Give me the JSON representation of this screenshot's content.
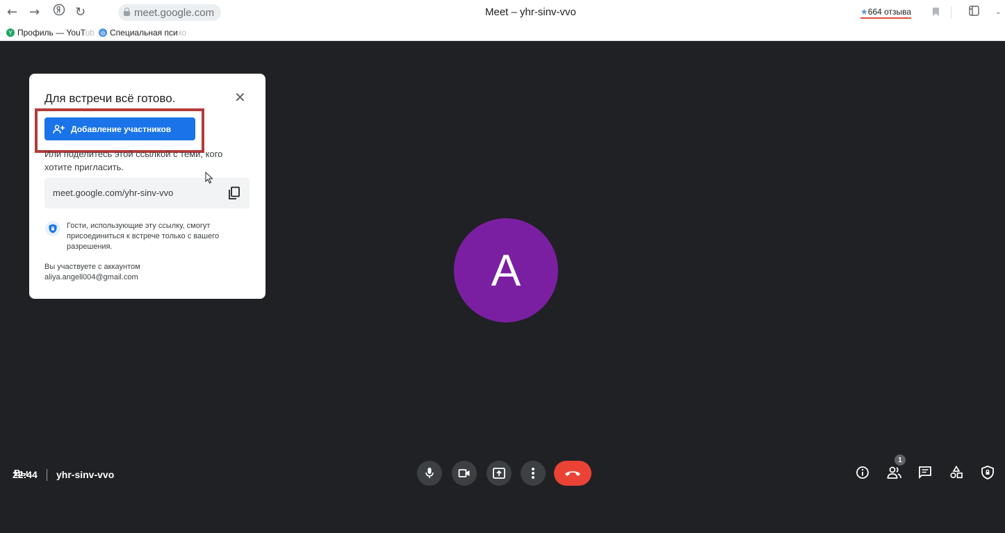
{
  "browser": {
    "url": "meet.google.com",
    "tab_title": "Meet – yhr-sinv-vvo",
    "reviews_star": "★",
    "reviews_label": "664 отзыва",
    "bookmarks": [
      {
        "label": "Профиль — YouT",
        "fade": "ub"
      },
      {
        "label": "Специальная пси",
        "fade": "хо"
      }
    ]
  },
  "panel": {
    "title": "Для встречи всё готово.",
    "add_button_label": "Добавление участников",
    "share_text": "Или поделитесь этой ссылкой с теми, кого хотите пригласить.",
    "meeting_link": "meet.google.com/yhr-sinv-vvo",
    "guest_notice": "Гости, использующие эту ссылку, смогут присоединиться к встрече только с вашего разрешения.",
    "account_label": "Вы участвуете с аккаунтом",
    "account_email": "aliya.angell004@gmail.com"
  },
  "stage": {
    "avatar_letter": "A",
    "self_label": "Вы"
  },
  "footer": {
    "time": "22:44",
    "meeting_code": "yhr-sinv-vvo",
    "participants_count": "1"
  },
  "colors": {
    "background": "#202124",
    "avatar": "#7b1fa2",
    "primary_button": "#1a73e8",
    "end_call": "#ea4335",
    "highlight_box": "#b53a3a"
  }
}
